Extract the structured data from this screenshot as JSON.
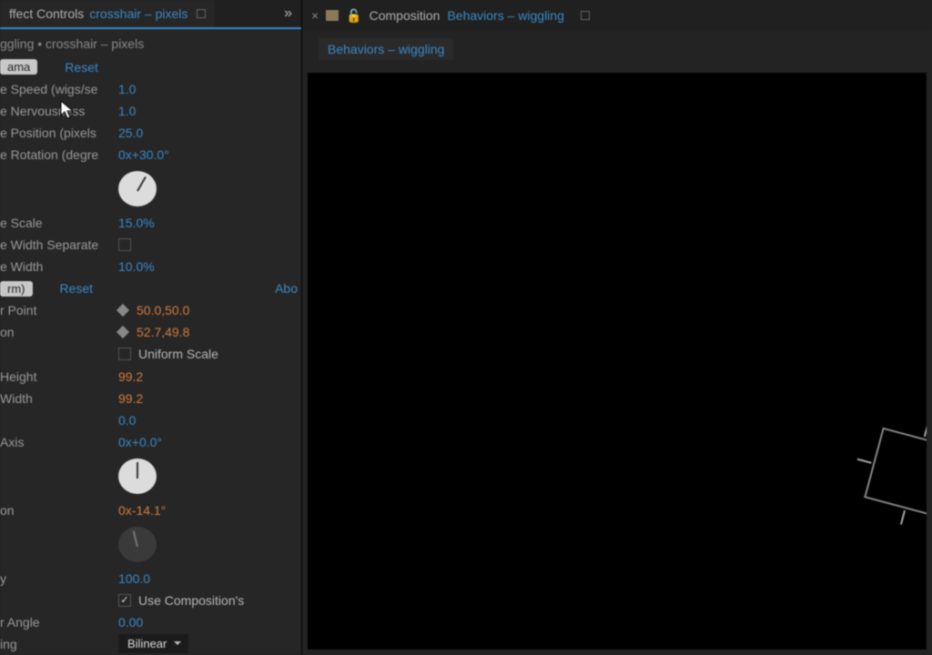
{
  "panel": {
    "effect_controls_label": "ffect Controls",
    "layer_link": "crosshair – pixels",
    "expand": "»",
    "breadcrumb": "ggling • crosshair – pixels"
  },
  "wigglerama": {
    "badge": "ama",
    "reset": "Reset",
    "rows": {
      "speed_label": "e Speed (wigs/se",
      "speed_val": "1.0",
      "nerv_label": "e Nervousness",
      "nerv_val": "1.0",
      "pos_label": "e Position (pixels",
      "pos_val": "25.0",
      "rot_label": "e Rotation (degre",
      "rot_val": "0x+30.0°",
      "scale_label": "e Scale",
      "scale_val": "15.0%",
      "widthsep_label": "e Width Separate",
      "width_label": "e Width",
      "width_val": "10.0%"
    }
  },
  "transform": {
    "badge": "rm)",
    "reset": "Reset",
    "about": "Abo",
    "rows": {
      "anchor_label": "r Point",
      "anchor_val": "50.0,50.0",
      "position_label": "on",
      "position_val": "52.7,49.8",
      "uniform_label": "Uniform Scale",
      "sheight_label": "Height",
      "sheight_val": "99.2",
      "swidth_label": "Width",
      "swidth_val": "99.2",
      "skew_val": "0.0",
      "axis_label": "Axis",
      "axis_val": "0x+0.0°",
      "rot_label": "on",
      "rot_val": "0x-14.1°",
      "opacity_label": "y",
      "opacity_val": "100.0",
      "usecomp_label": "Use Composition's",
      "shutter_label": "r Angle",
      "shutter_val": "0.00",
      "sampling_label": "ing",
      "sampling_val": "Bilinear"
    }
  },
  "composition": {
    "tab_label": "Composition",
    "tab_link": "Behaviors – wiggling",
    "subtab": "Behaviors – wiggling"
  }
}
